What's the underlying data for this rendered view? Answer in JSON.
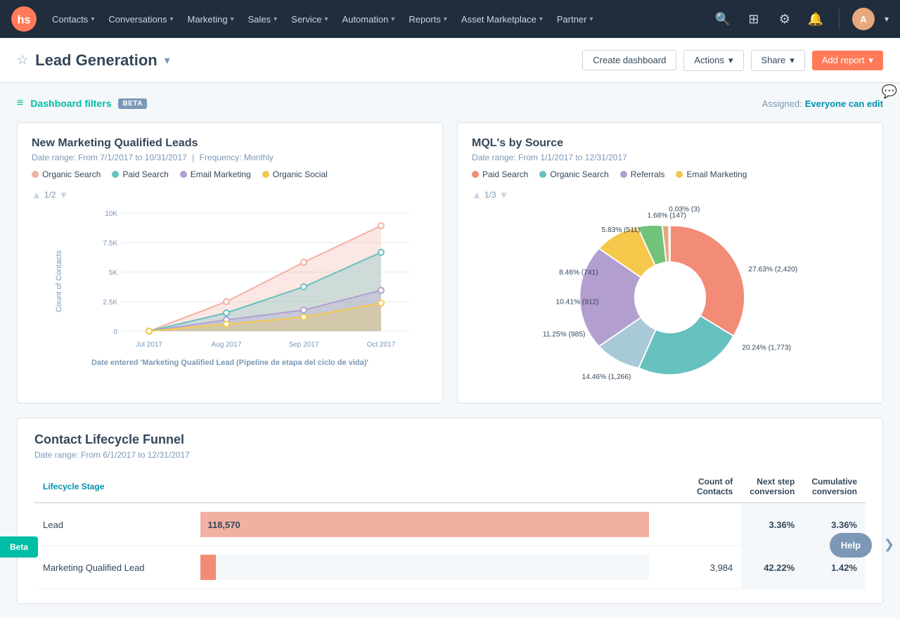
{
  "nav": {
    "items": [
      {
        "label": "Contacts",
        "hasDropdown": true
      },
      {
        "label": "Conversations",
        "hasDropdown": true
      },
      {
        "label": "Marketing",
        "hasDropdown": true
      },
      {
        "label": "Sales",
        "hasDropdown": true
      },
      {
        "label": "Service",
        "hasDropdown": true
      },
      {
        "label": "Automation",
        "hasDropdown": true
      },
      {
        "label": "Reports",
        "hasDropdown": true
      },
      {
        "label": "Asset Marketplace",
        "hasDropdown": true
      },
      {
        "label": "Partner",
        "hasDropdown": true
      }
    ]
  },
  "header": {
    "title": "Lead Generation",
    "create_dashboard": "Create dashboard",
    "actions": "Actions",
    "share": "Share",
    "add_report": "Add report"
  },
  "filters": {
    "label": "Dashboard filters",
    "beta": "BETA",
    "assigned_label": "Assigned:",
    "assigned_value": "Everyone can edit"
  },
  "chart1": {
    "title": "New Marketing Qualified Leads",
    "date_range": "Date range: From 7/1/2017 to 10/31/2017",
    "frequency": "Frequency: Monthly",
    "page": "1/2",
    "legend": [
      {
        "label": "Organic Search",
        "color": "#f2b0a2"
      },
      {
        "label": "Paid Search",
        "color": "#67c1bf"
      },
      {
        "label": "Email Marketing",
        "color": "#b29fd0"
      },
      {
        "label": "Organic Social",
        "color": "#f5c84c"
      }
    ],
    "x_label": "Date entered 'Marketing Qualified Lead (Pipeline de etapa del ciclo de vida)'",
    "y_label": "Count of Contacts",
    "x_ticks": [
      "Jul 2017",
      "Aug 2017",
      "Sep 2017",
      "Oct 2017"
    ],
    "y_ticks": [
      "0",
      "2.5K",
      "5K",
      "7.5K",
      "10K"
    ]
  },
  "chart2": {
    "title": "MQL's by Source",
    "date_range": "Date range: From 1/1/2017 to 12/31/2017",
    "page": "1/3",
    "legend": [
      {
        "label": "Paid Search",
        "color": "#f28c77"
      },
      {
        "label": "Organic Search",
        "color": "#67c1bf"
      },
      {
        "label": "Referrals",
        "color": "#b29fd0"
      },
      {
        "label": "Email Marketing",
        "color": "#f5c84c"
      }
    ],
    "segments": [
      {
        "label": "27.63% (2,420)",
        "value": 27.63,
        "color": "#f28c77"
      },
      {
        "label": "20.24% (1,773)",
        "value": 20.24,
        "color": "#67c1bf"
      },
      {
        "label": "14.46% (1,266)",
        "value": 14.46,
        "color": "#a8c9d8"
      },
      {
        "label": "11.25% (985)",
        "value": 11.25,
        "color": "#b29fd0"
      },
      {
        "label": "10.41% (912)",
        "value": 10.41,
        "color": "#f5c84c"
      },
      {
        "label": "8.46% (741)",
        "value": 8.46,
        "color": "#72c27a"
      },
      {
        "label": "5.83% (511)",
        "value": 5.83,
        "color": "#e8a87c"
      },
      {
        "label": "1.68% (147)",
        "value": 1.68,
        "color": "#cbd6e2"
      },
      {
        "label": "0.03% (3)",
        "value": 0.03,
        "color": "#85c1a3"
      }
    ]
  },
  "funnel": {
    "title": "Contact Lifecycle Funnel",
    "date_range": "Date range: From 6/1/2017 to 12/31/2017",
    "columns": [
      "Lifecycle Stage",
      "",
      "Count of Contacts",
      "Next step conversion",
      "Cumulative conversion"
    ],
    "rows": [
      {
        "stage": "Lead",
        "count": "118,570",
        "count_raw": 118570,
        "bar_pct": 100,
        "bar_color": "#f2b0a2",
        "next_step": "3.36%",
        "cumulative": "3.36%"
      },
      {
        "stage": "Marketing Qualified Lead",
        "count": "3,984",
        "count_raw": 3984,
        "bar_pct": 3.36,
        "bar_color": "#f28c77",
        "next_step": "42.22%",
        "cumulative": "1.42%"
      }
    ]
  }
}
